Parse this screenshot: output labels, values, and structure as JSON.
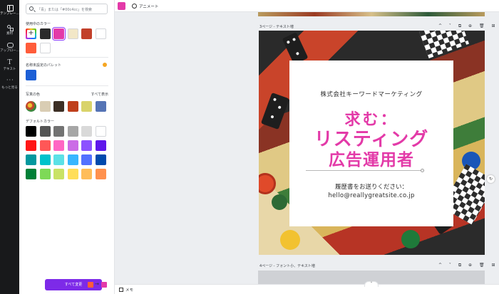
{
  "rail": {
    "items": [
      {
        "label": "テンプレー...",
        "icon": "template-icon"
      },
      {
        "label": "素材",
        "icon": "elements-icon"
      },
      {
        "label": "アップロー...",
        "icon": "upload-icon"
      },
      {
        "label": "テキスト",
        "icon": "text-icon"
      },
      {
        "label": "もっと見る",
        "icon": "more-icon"
      }
    ]
  },
  "panel": {
    "search_placeholder": "「青」または「#00c4cc」を検索",
    "in_use_title": "使用中のカラー",
    "in_use_colors": [
      "#2b2b2b",
      "#e33aa8",
      "#f2e7c7",
      "#c2402a",
      "#ffffff",
      "#ff5c3a",
      "#ffffff"
    ],
    "brand_title": "名称未設定のパレット",
    "brand_colors": [
      "#1c5fd6"
    ],
    "photo_title": "写真の色",
    "photo_link": "すべて表示",
    "photo_colors": [
      "#d9cdb4",
      "#3d2f25",
      "#bf3f1c",
      "#d9d36a",
      "#5574b5"
    ],
    "default_title": "デフォルトカラー",
    "default_colors": [
      [
        "#000000",
        "#545454",
        "#737373",
        "#a6a6a6",
        "#d9d9d9",
        "#ffffff"
      ],
      [
        "#ff1616",
        "#ff5757",
        "#ff66c4",
        "#cb6ce6",
        "#8c52ff",
        "#5e17eb"
      ],
      [
        "#03989e",
        "#00c2cb",
        "#5ce1e6",
        "#38b6ff",
        "#5271ff",
        "#004aad"
      ],
      [
        "#008037",
        "#7ed957",
        "#c9e265",
        "#ffde59",
        "#ffbd59",
        "#ff914d"
      ]
    ],
    "apply_all_label": "すべて変更",
    "swap_from": "#ff5c3a",
    "swap_to": "#e33aa8",
    "swap_arrow": "→"
  },
  "toolbar": {
    "current_color": "#e33aa8",
    "animate_label": "アニメート"
  },
  "canvas": {
    "page3_label": "3ページ - テキスト増",
    "page4_label": "4ページ - フォント小、テキスト増",
    "page_controls": "^ ˅ ⧉ ⊕ 🗑 ⊞"
  },
  "design": {
    "company": "株式会社キーワードマーケティング",
    "headline_line1": "求む：",
    "headline_line2": "リスティング",
    "headline_line3": "広告運用者",
    "contact_line1": "履歴書をお送りください：",
    "contact_line2": "hello@reallygreatsite.co.jp",
    "accent_color": "#e33aa8"
  },
  "bottombar": {
    "memo_label": "メモ",
    "collapse_glyph": "˄"
  }
}
